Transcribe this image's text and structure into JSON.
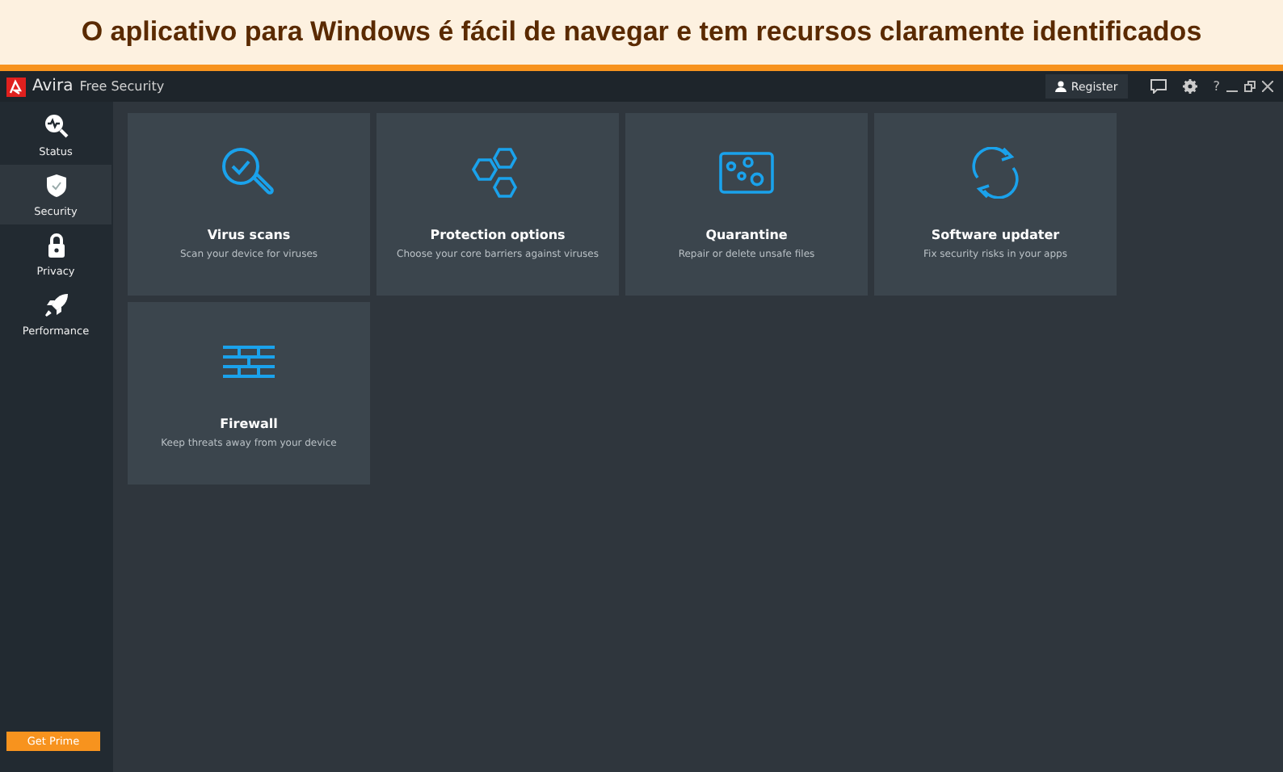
{
  "banner": {
    "caption": "O aplicativo para Windows é fácil de navegar e tem recursos claramente identificados"
  },
  "window": {
    "title": "Avira",
    "subtitle": "Free Security",
    "register": "Register",
    "help": "?"
  },
  "sidebar": {
    "items": [
      {
        "label": "Status",
        "selected": false
      },
      {
        "label": "Security",
        "selected": true
      },
      {
        "label": "Privacy",
        "selected": false
      },
      {
        "label": "Performance",
        "selected": false
      }
    ],
    "button": "Get Prime"
  },
  "cards": [
    {
      "title": "Virus scans",
      "description": "Scan your device for viruses"
    },
    {
      "title": "Protection options",
      "description": "Choose your core barriers against viruses"
    },
    {
      "title": "Quarantine",
      "description": "Repair or delete unsafe files"
    },
    {
      "title": "Software updater",
      "description": "Fix security risks in your apps"
    },
    {
      "title": "Firewall",
      "description": "Keep threats away from your device"
    }
  ]
}
